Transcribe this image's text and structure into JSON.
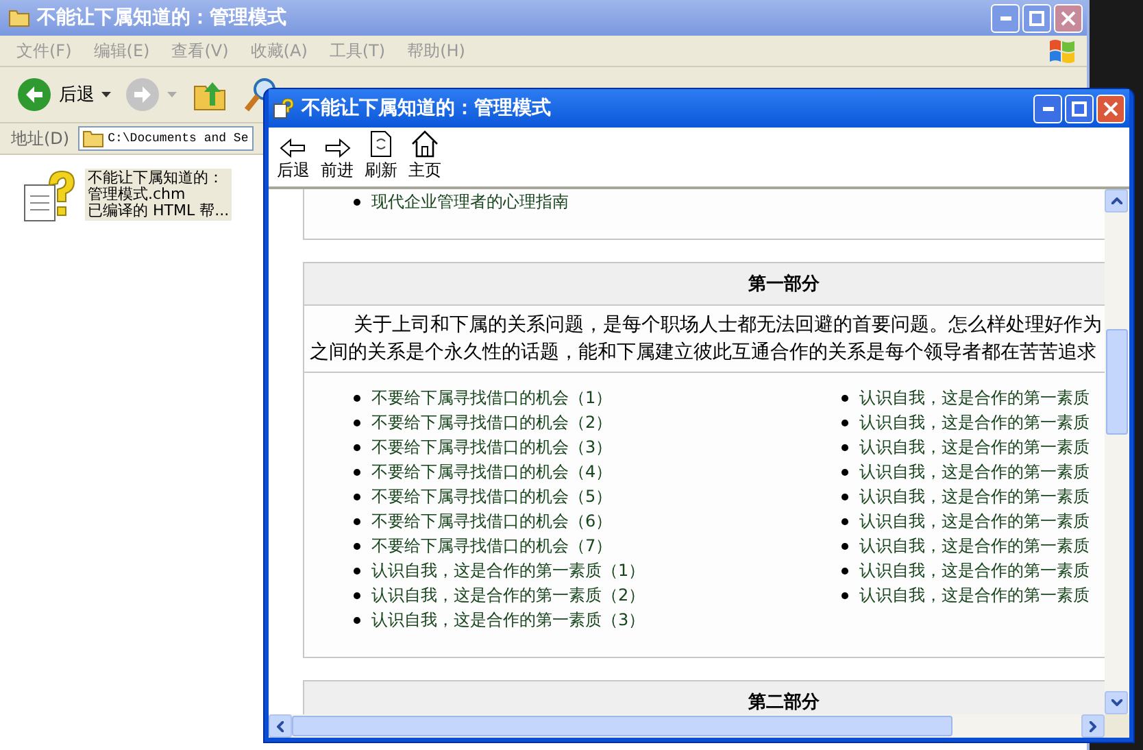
{
  "explorer": {
    "title": "不能让下属知道的：管理模式",
    "menu": [
      "文件(F)",
      "编辑(E)",
      "查看(V)",
      "收藏(A)",
      "工具(T)",
      "帮助(H)"
    ],
    "toolbar": [
      {
        "kind": "back",
        "label": "后退",
        "disabled": false
      },
      {
        "kind": "forward",
        "disabled": true
      },
      {
        "kind": "up"
      },
      {
        "kind": "search"
      }
    ],
    "address_label": "地址(D)",
    "address": "C:\\Documents and Se",
    "file": {
      "name_lines": [
        "不能让下属知道的：",
        "管理模式.chm"
      ],
      "type": "已编译的 HTML 帮...",
      "selected": true
    }
  },
  "help_window": {
    "title": "不能让下属知道的：管理模式",
    "toolbar": [
      {
        "kind": "back",
        "label": "后退"
      },
      {
        "kind": "forward",
        "label": "前进"
      },
      {
        "kind": "refresh",
        "label": "刷新"
      },
      {
        "kind": "home",
        "label": "主页"
      }
    ],
    "sections": [
      {
        "kind": "list",
        "items": [
          "现代企业管理者的心理指南"
        ]
      },
      {
        "kind": "part",
        "heading": "第一部分",
        "paragraph_lines": [
          "关于上司和下属的关系问题，是每个职场人士都无法回避的首要问题。怎么样处理好作为",
          "之间的关系是个永久性的话题，能和下属建立彼此互通合作的关系是每个领导者都在苦苦追求"
        ],
        "columns": [
          [
            "不要给下属寻找借口的机会（1）",
            "不要给下属寻找借口的机会（2）",
            "不要给下属寻找借口的机会（3）",
            "不要给下属寻找借口的机会（4）",
            "不要给下属寻找借口的机会（5）",
            "不要给下属寻找借口的机会（6）",
            "不要给下属寻找借口的机会（7）",
            "认识自我，这是合作的第一素质（1）",
            "认识自我，这是合作的第一素质（2）",
            "认识自我，这是合作的第一素质（3）"
          ],
          [
            "认识自我，这是合作的第一素质",
            "认识自我，这是合作的第一素质",
            "认识自我，这是合作的第一素质",
            "认识自我，这是合作的第一素质",
            "认识自我，这是合作的第一素质",
            "认识自我，这是合作的第一素质",
            "认识自我，这是合作的第一素质",
            "认识自我，这是合作的第一素质",
            "认识自我，这是合作的第一素质"
          ]
        ]
      },
      {
        "kind": "part",
        "heading": "第二部分"
      }
    ]
  }
}
